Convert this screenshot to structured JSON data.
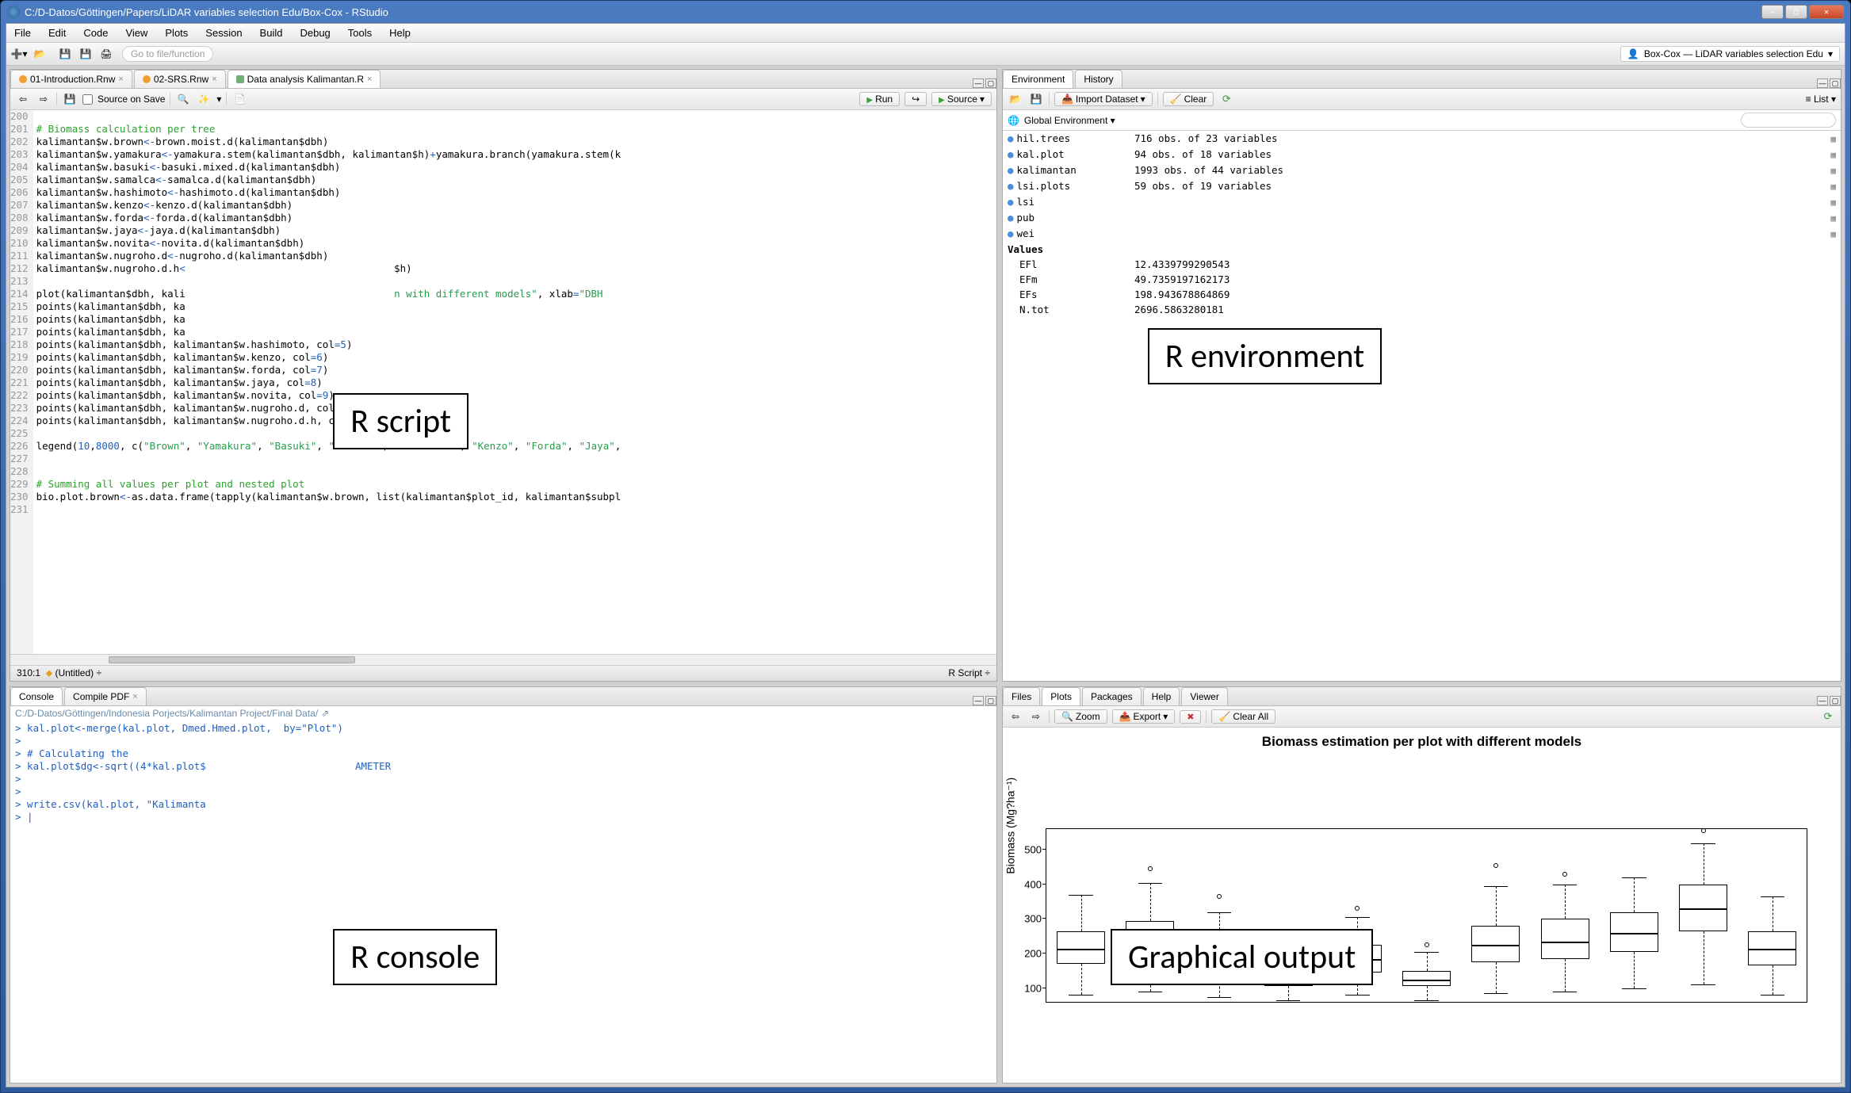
{
  "window": {
    "title": "C:/D-Datos/Göttingen/Papers/LiDAR variables selection Edu/Box-Cox - RStudio",
    "min": "—",
    "max": "▢",
    "close": "✕"
  },
  "menubar": [
    "File",
    "Edit",
    "Code",
    "View",
    "Plots",
    "Session",
    "Build",
    "Debug",
    "Tools",
    "Help"
  ],
  "toolbar": {
    "goto_placeholder": "Go to file/function",
    "project": "Box-Cox — LiDAR variables selection Edu"
  },
  "editor": {
    "tabs": [
      {
        "label": "01-Introduction.Rnw"
      },
      {
        "label": "02-SRS.Rnw"
      },
      {
        "label": "Data analysis Kalimantan.R",
        "active": true
      }
    ],
    "source_on_save": "Source on Save",
    "run": "Run",
    "source": "Source",
    "lines": [
      {
        "n": 200,
        "html": ""
      },
      {
        "n": 201,
        "html": "<span class='c-comment'># Biomass calculation per tree</span>"
      },
      {
        "n": 202,
        "html": "kalimantan$w.brown<span class='c-op'>&lt;-</span>brown.moist.d(kalimantan$dbh)"
      },
      {
        "n": 203,
        "html": "kalimantan$w.yamakura<span class='c-op'>&lt;-</span>yamakura.stem(kalimantan$dbh, kalimantan$h)<span class='c-op'>+</span>yamakura.branch(yamakura.stem(k"
      },
      {
        "n": 204,
        "html": "kalimantan$w.basuki<span class='c-op'>&lt;-</span>basuki.mixed.d(kalimantan$dbh)"
      },
      {
        "n": 205,
        "html": "kalimantan$w.samalca<span class='c-op'>&lt;-</span>samalca.d(kalimantan$dbh)"
      },
      {
        "n": 206,
        "html": "kalimantan$w.hashimoto<span class='c-op'>&lt;-</span>hashimoto.d(kalimantan$dbh)"
      },
      {
        "n": 207,
        "html": "kalimantan$w.kenzo<span class='c-op'>&lt;-</span>kenzo.d(kalimantan$dbh)"
      },
      {
        "n": 208,
        "html": "kalimantan$w.forda<span class='c-op'>&lt;-</span>forda.d(kalimantan$dbh)"
      },
      {
        "n": 209,
        "html": "kalimantan$w.jaya<span class='c-op'>&lt;-</span>jaya.d(kalimantan$dbh)"
      },
      {
        "n": 210,
        "html": "kalimantan$w.novita<span class='c-op'>&lt;-</span>novita.d(kalimantan$dbh)"
      },
      {
        "n": 211,
        "html": "kalimantan$w.nugroho.d<span class='c-op'>&lt;-</span>nugroho.d(kalimantan$dbh)"
      },
      {
        "n": 212,
        "html": "kalimantan$w.nugroho.d.h<span class='c-op'>&lt;</span>                                   $h)"
      },
      {
        "n": 213,
        "html": ""
      },
      {
        "n": 214,
        "html": "plot(kalimantan$dbh, kali                                   <span class='c-str'>n with different models\"</span>, xlab<span class='c-op'>=</span><span class='c-str'>\"DBH</span>"
      },
      {
        "n": 215,
        "html": "points(kalimantan$dbh, ka"
      },
      {
        "n": 216,
        "html": "points(kalimantan$dbh, ka"
      },
      {
        "n": 217,
        "html": "points(kalimantan$dbh, ka"
      },
      {
        "n": 218,
        "html": "points(kalimantan$dbh, kalimantan$w.hashimoto, col<span class='c-op'>=</span><span class='c-num'>5</span>)"
      },
      {
        "n": 219,
        "html": "points(kalimantan$dbh, kalimantan$w.kenzo, col<span class='c-op'>=</span><span class='c-num'>6</span>)"
      },
      {
        "n": 220,
        "html": "points(kalimantan$dbh, kalimantan$w.forda, col<span class='c-op'>=</span><span class='c-num'>7</span>)"
      },
      {
        "n": 221,
        "html": "points(kalimantan$dbh, kalimantan$w.jaya, col<span class='c-op'>=</span><span class='c-num'>8</span>)"
      },
      {
        "n": 222,
        "html": "points(kalimantan$dbh, kalimantan$w.novita, col<span class='c-op'>=</span><span class='c-num'>9</span>)"
      },
      {
        "n": 223,
        "html": "points(kalimantan$dbh, kalimantan$w.nugroho.d, col<span class='c-op'>=</span><span class='c-num'>10</span>)"
      },
      {
        "n": 224,
        "html": "points(kalimantan$dbh, kalimantan$w.nugroho.d.h, col<span class='c-op'>=</span><span class='c-num'>11</span>)"
      },
      {
        "n": 225,
        "html": ""
      },
      {
        "n": 226,
        "html": "legend(<span class='c-num'>10</span>,<span class='c-num'>8000</span>, c(<span class='c-str'>\"Brown\"</span>, <span class='c-str'>\"Yamakura\"</span>, <span class='c-str'>\"Basuki\"</span>, <span class='c-str'>\"Samalca\"</span>, <span class='c-str'>\"Hashimoto\"</span>, <span class='c-str'>\"Kenzo\"</span>, <span class='c-str'>\"Forda\"</span>, <span class='c-str'>\"Jaya\"</span>,"
      },
      {
        "n": 227,
        "html": ""
      },
      {
        "n": 228,
        "html": ""
      },
      {
        "n": 229,
        "html": "<span class='c-comment'># Summing all values per plot and nested plot</span>"
      },
      {
        "n": 230,
        "html": "bio.plot.brown<span class='c-op'>&lt;-</span>as.data.frame(tapply(kalimantan$w.brown, list(kalimantan$plot_id, kalimantan$subpl<span class='c-op'></span>"
      },
      {
        "n": 231,
        "html": ""
      }
    ],
    "status_left": "310:1",
    "status_mid": "(Untitled)",
    "status_right": "R Script",
    "untitled_dot": "⬥"
  },
  "console": {
    "tabs": [
      {
        "label": "Console",
        "active": true
      },
      {
        "label": "Compile PDF"
      }
    ],
    "path": "C:/D-Datos/Göttingen/Indonesia Porjects/Kalimantan Project/Final Data/",
    "lines": [
      "> kal.plot<-merge(kal.plot, Dmed.Hmed.plot,  by=\"Plot\")",
      "> ",
      "> # Calculating the",
      "> kal.plot$dg<-sqrt((4*kal.plot$                         AMETER",
      "> ",
      "> ",
      "> write.csv(kal.plot, \"Kalimanta",
      "> |"
    ]
  },
  "env": {
    "tabs": [
      {
        "label": "Environment",
        "active": true
      },
      {
        "label": "History"
      }
    ],
    "import": "Import Dataset",
    "clear": "Clear",
    "scope": "Global Environment",
    "list": "List",
    "data": [
      {
        "name": "hil.trees",
        "val": "716 obs. of 23 variables"
      },
      {
        "name": "kal.plot",
        "val": "94 obs. of 18 variables"
      },
      {
        "name": "kalimantan",
        "val": "1993 obs. of 44 variables"
      },
      {
        "name": "lsi.plots",
        "val": "59 obs. of 19 variables"
      },
      {
        "name": "lsi",
        "val": ""
      },
      {
        "name": "pub",
        "val": ""
      },
      {
        "name": "wei",
        "val": ""
      }
    ],
    "values_head": "Values",
    "values": [
      {
        "name": "EFl",
        "val": "12.4339799290543"
      },
      {
        "name": "EFm",
        "val": "49.7359197162173"
      },
      {
        "name": "EFs",
        "val": "198.943678864869"
      },
      {
        "name": "N.tot",
        "val": "2696.5863280181"
      }
    ]
  },
  "plots": {
    "tabs": [
      {
        "label": "Files"
      },
      {
        "label": "Plots",
        "active": true
      },
      {
        "label": "Packages"
      },
      {
        "label": "Help"
      },
      {
        "label": "Viewer"
      }
    ],
    "zoom": "Zoom",
    "export": "Export",
    "clear_all": "Clear All"
  },
  "chart_data": {
    "type": "boxplot",
    "title": "Biomass estimation per plot with different models",
    "ylabel": "Biomass (Mg?ha⁻¹)",
    "ylim": [
      60,
      560
    ],
    "yticks": [
      100,
      200,
      300,
      400,
      500
    ],
    "n_boxes": 11,
    "series": [
      {
        "low_whisk": 80,
        "q1": 170,
        "median": 215,
        "q3": 265,
        "high_whisk": 370,
        "outliers": []
      },
      {
        "low_whisk": 90,
        "q1": 180,
        "median": 235,
        "q3": 295,
        "high_whisk": 405,
        "outliers": [
          445
        ]
      },
      {
        "low_whisk": 75,
        "q1": 140,
        "median": 185,
        "q3": 225,
        "high_whisk": 320,
        "outliers": [
          365
        ]
      },
      {
        "low_whisk": 65,
        "q1": 105,
        "median": 125,
        "q3": 150,
        "high_whisk": 210,
        "outliers": [
          230
        ]
      },
      {
        "low_whisk": 80,
        "q1": 145,
        "median": 185,
        "q3": 225,
        "high_whisk": 305,
        "outliers": [
          330
        ]
      },
      {
        "low_whisk": 65,
        "q1": 105,
        "median": 125,
        "q3": 150,
        "high_whisk": 205,
        "outliers": [
          225
        ]
      },
      {
        "low_whisk": 85,
        "q1": 175,
        "median": 225,
        "q3": 280,
        "high_whisk": 395,
        "outliers": [
          455
        ]
      },
      {
        "low_whisk": 90,
        "q1": 185,
        "median": 235,
        "q3": 300,
        "high_whisk": 400,
        "outliers": [
          430
        ]
      },
      {
        "low_whisk": 100,
        "q1": 205,
        "median": 260,
        "q3": 320,
        "high_whisk": 420,
        "outliers": []
      },
      {
        "low_whisk": 110,
        "q1": 265,
        "median": 330,
        "q3": 400,
        "high_whisk": 520,
        "outliers": [
          555
        ]
      },
      {
        "low_whisk": 80,
        "q1": 165,
        "median": 215,
        "q3": 265,
        "high_whisk": 365,
        "outliers": []
      }
    ]
  },
  "annotations": {
    "script": "R script",
    "console": "R console",
    "env": "R environment",
    "plot": "Graphical output"
  }
}
